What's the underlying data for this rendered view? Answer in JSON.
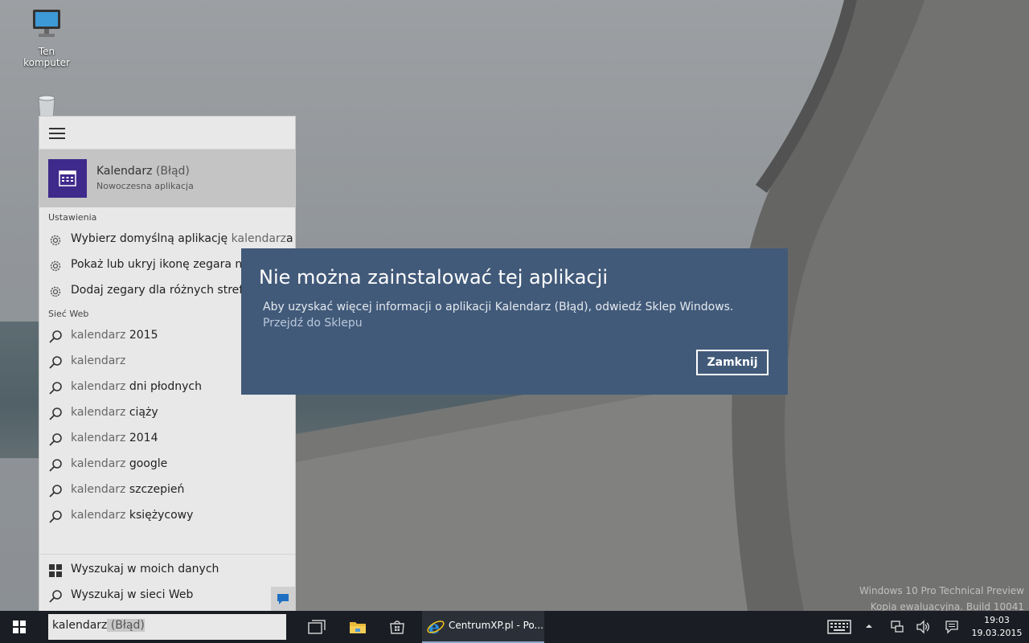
{
  "desktop": {
    "icons": [
      {
        "label": "Ten komputer",
        "icon": "computer-icon"
      },
      {
        "label": "",
        "icon": "recycle-bin-icon"
      }
    ],
    "watermark": [
      "Windows 10 Pro Technical Preview",
      "Kopia ewaluacyjna. Build 10041"
    ]
  },
  "start_menu": {
    "best_match": {
      "title_main": "Kalendarz",
      "title_suffix": " (Błąd)",
      "subtitle": "Nowoczesna aplikacja",
      "icon": "calendar-icon",
      "tile_color": "#3e2a8b"
    },
    "settings_header": "Ustawienia",
    "settings": [
      {
        "before": "Wybierz domyślną aplikację ",
        "match": "kalendarz",
        "after": "a"
      },
      {
        "before": "Pokaż lub ukryj ikonę zegara na",
        "match": "",
        "after": ""
      },
      {
        "before": "Dodaj zegary dla różnych stref c",
        "match": "",
        "after": ""
      }
    ],
    "web_header": "Sieć Web",
    "web": [
      {
        "match": "kalendarz",
        "rest": " 2015"
      },
      {
        "match": "kalendarz",
        "rest": ""
      },
      {
        "match": "kalendarz",
        "rest": " dni płodnych"
      },
      {
        "match": "kalendarz",
        "rest": " ciąży"
      },
      {
        "match": "kalendarz",
        "rest": " 2014"
      },
      {
        "match": "kalendarz",
        "rest": " google"
      },
      {
        "match": "kalendarz",
        "rest": " szczepień"
      },
      {
        "match": "kalendarz",
        "rest": " księżycowy"
      }
    ],
    "footer": {
      "my_stuff": "Wyszukaj w moich danych",
      "web": "Wyszukaj w sieci Web"
    }
  },
  "dialog": {
    "title": "Nie można zainstalować tej aplikacji",
    "message": "Aby uzyskać więcej informacji o aplikacji Kalendarz (Błąd), odwiedź Sklep Windows.",
    "link": "Przejdź do Sklepu",
    "button": "Zamknij",
    "background": "#425a79"
  },
  "taskbar": {
    "search_typed": "kalendarz",
    "search_suggest": " (Błąd)",
    "ie_label": "CentrumXP.pl - Po...",
    "time": "19:03",
    "date": "19.03.2015"
  }
}
